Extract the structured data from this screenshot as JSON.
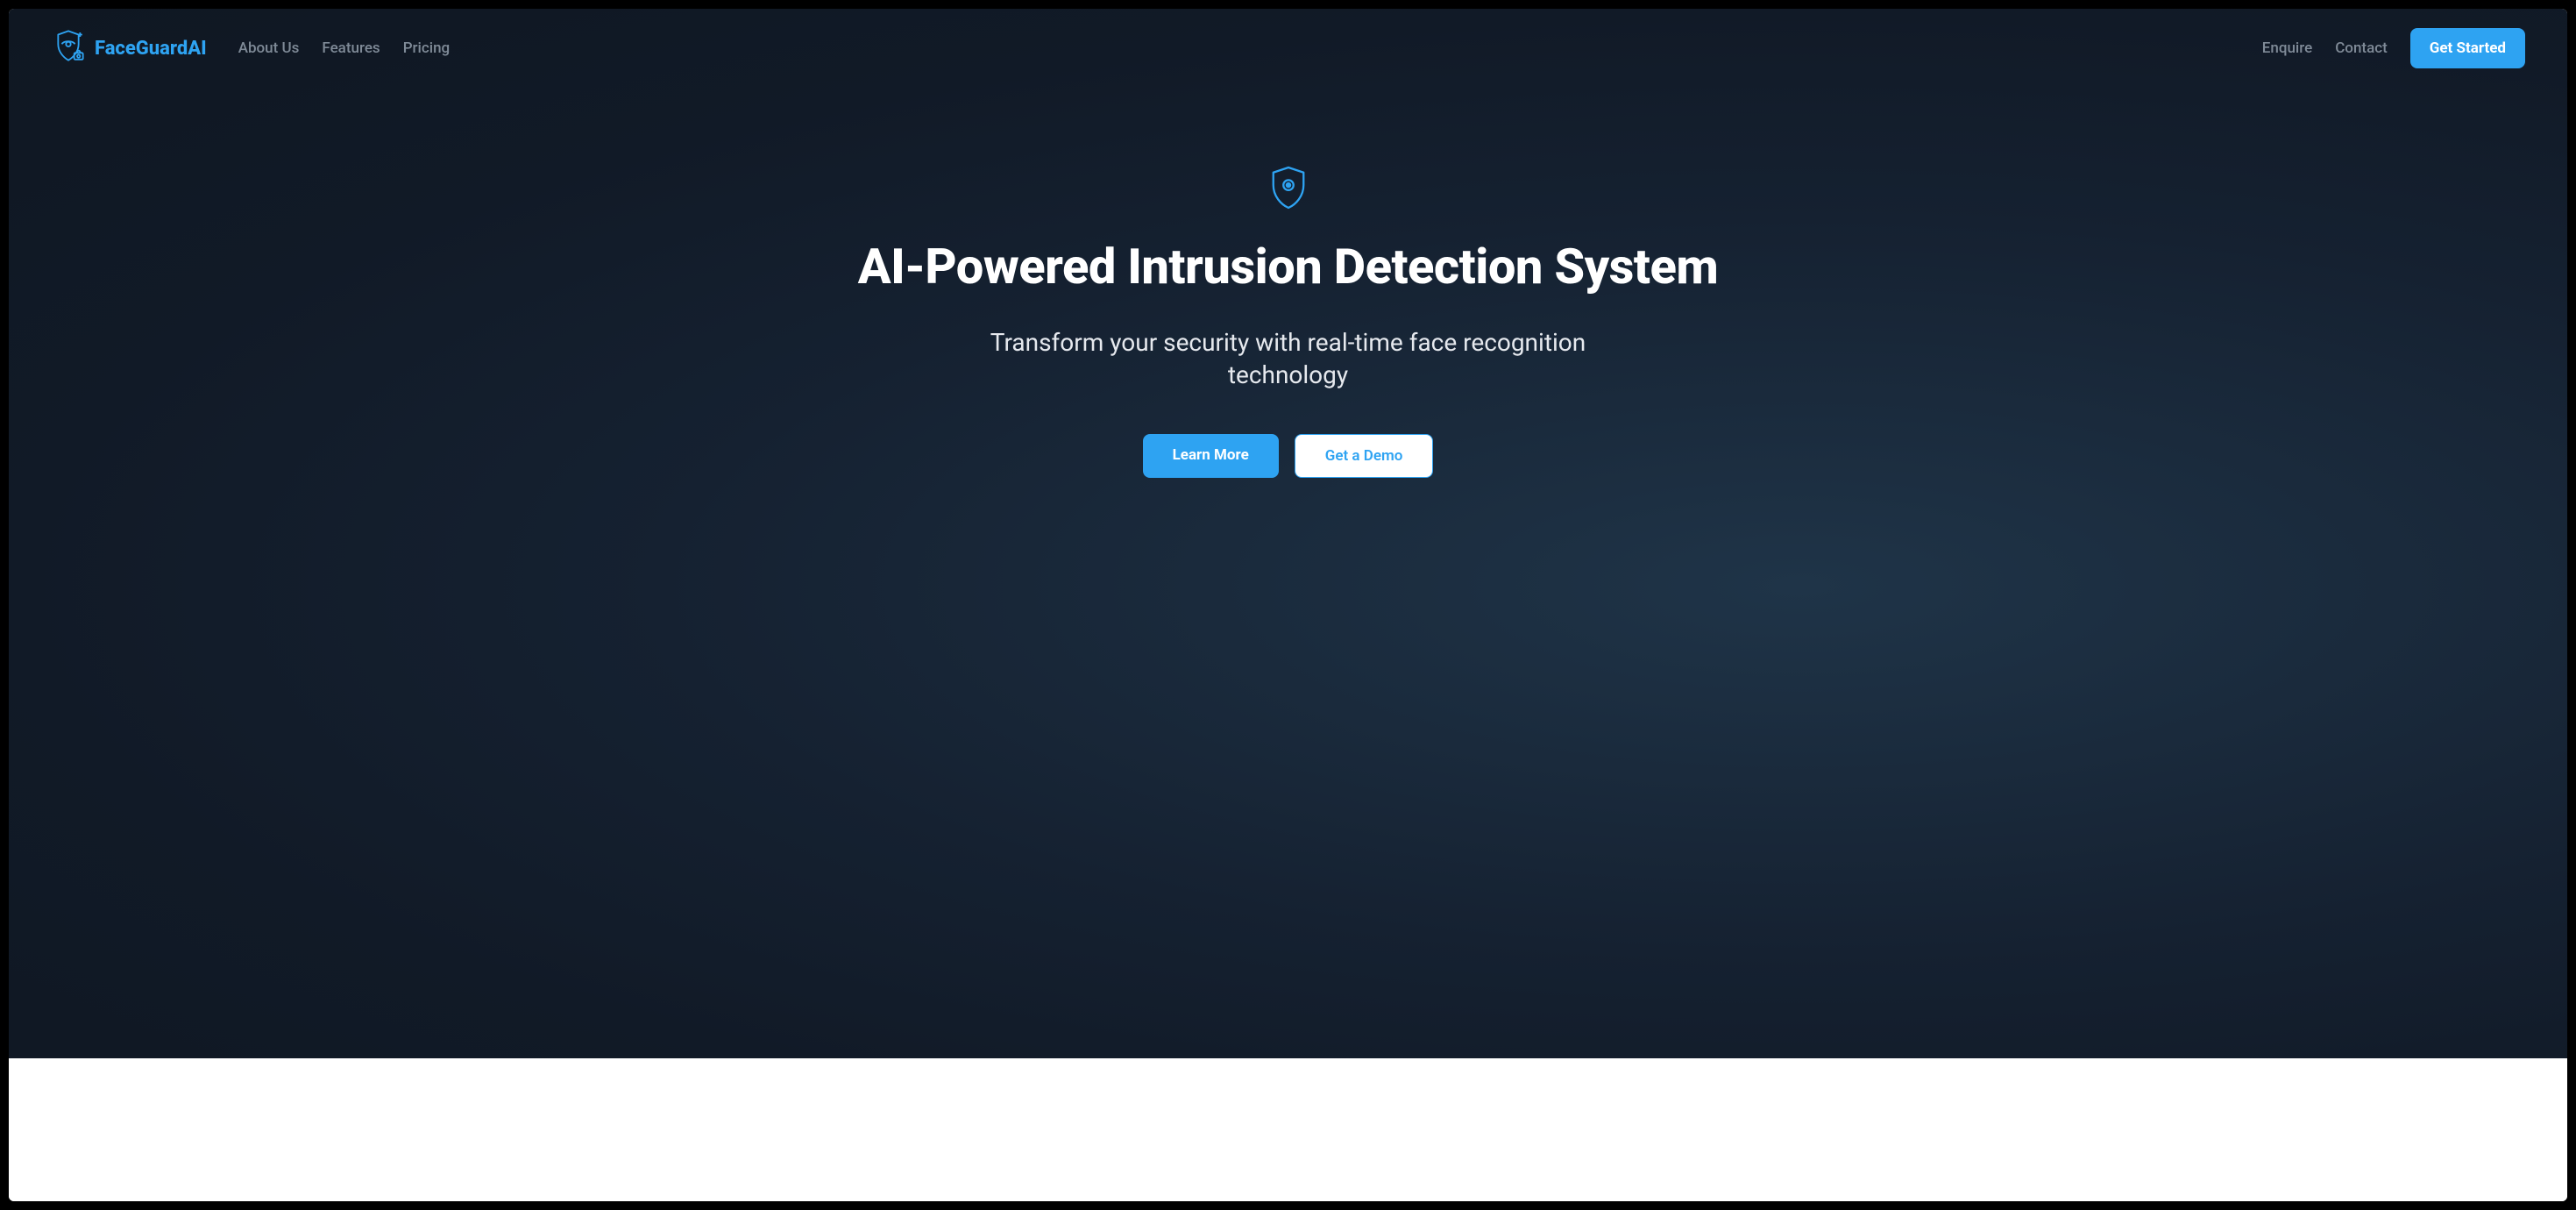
{
  "brand": {
    "name": "FaceGuardAI"
  },
  "nav": {
    "left": [
      {
        "label": "About Us"
      },
      {
        "label": "Features"
      },
      {
        "label": "Pricing"
      }
    ],
    "right": [
      {
        "label": "Enquire"
      },
      {
        "label": "Contact"
      }
    ],
    "cta": {
      "label": "Get Started"
    }
  },
  "hero": {
    "title": "AI-Powered Intrusion Detection System",
    "subtitle": "Transform your security with real-time face recognition technology",
    "primary_cta": "Learn More",
    "secondary_cta": "Get a Demo"
  },
  "colors": {
    "accent": "#2EA3F2"
  }
}
